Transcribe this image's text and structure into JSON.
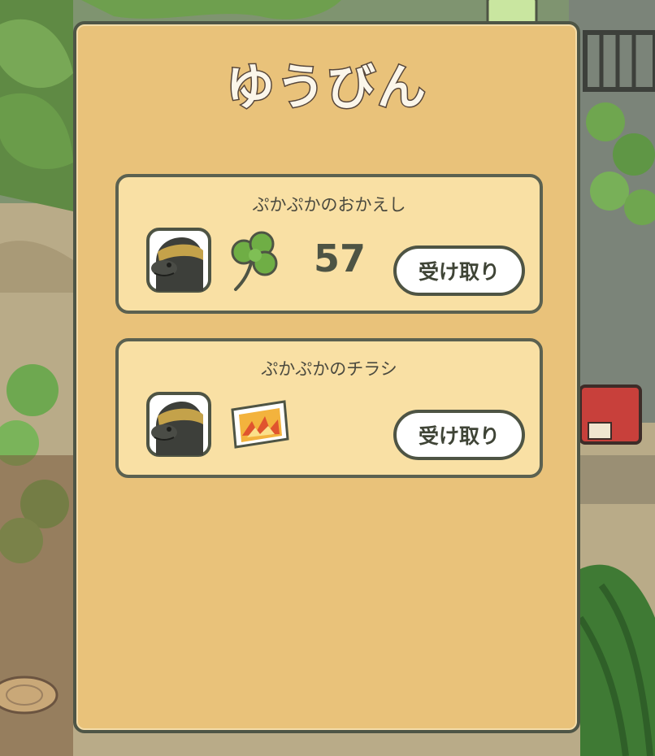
{
  "mailbox": {
    "title": "ゆうびん"
  },
  "mail_items": [
    {
      "title": "ぷかぷかのおかえし",
      "sender_icon": "tortoise-avatar-icon",
      "reward_icon": "clover-icon",
      "reward_count": "57",
      "receive_label": "受け取り"
    },
    {
      "title": "ぷかぷかのチラシ",
      "sender_icon": "tortoise-avatar-icon",
      "reward_icon": "flyer-icon",
      "receive_label": "受け取り"
    }
  ],
  "colors": {
    "panel": "#e9c27a",
    "card": "#f9e0a4",
    "outline": "#4e5444",
    "button": "#ffffff",
    "clover": "#6fae45"
  }
}
